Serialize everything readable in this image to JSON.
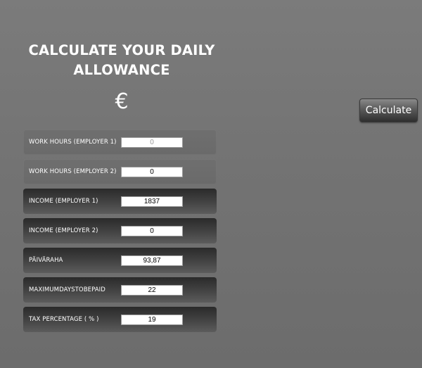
{
  "title": "CALCULATE YOUR DAILY ALLOWANCE",
  "currency_symbol": "€",
  "calculate_button": "Calculate",
  "fields": [
    {
      "label": "WORK HOURS (EMPLOYER 1)",
      "value": "",
      "placeholder": "0"
    },
    {
      "label": "WORK HOURS (EMPLOYER 2)",
      "value": "0",
      "placeholder": ""
    },
    {
      "label": "INCOME (EMPLOYER 1)",
      "value": "1837",
      "placeholder": ""
    },
    {
      "label": "INCOME (EMPLOYER 2)",
      "value": "0",
      "placeholder": ""
    },
    {
      "label": "PÄIVÄRAHA",
      "value": "93,87",
      "placeholder": ""
    },
    {
      "label": "MAXIMUMDAYSTOBEPAID",
      "value": "22",
      "placeholder": ""
    },
    {
      "label": "TAX PERCENTAGE ( % )",
      "value": "19",
      "placeholder": ""
    }
  ]
}
